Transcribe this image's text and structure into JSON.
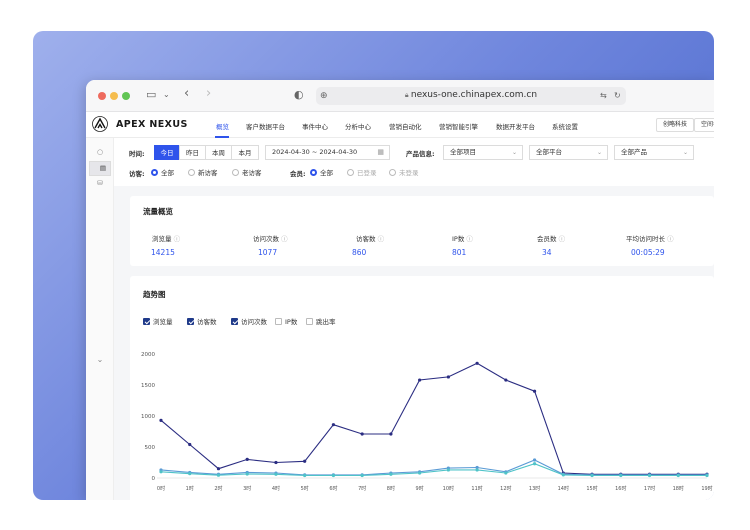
{
  "browser": {
    "url": "nexus-one.chinapex.com.cn"
  },
  "brand": {
    "name": "APEX NEXUS"
  },
  "nav": [
    {
      "label": "概览",
      "active": true
    },
    {
      "label": "客户数据平台"
    },
    {
      "label": "事件中心"
    },
    {
      "label": "分析中心"
    },
    {
      "label": "营销自动化"
    },
    {
      "label": "营销智能引擎"
    },
    {
      "label": "数据开发平台"
    },
    {
      "label": "系统设置"
    }
  ],
  "header_buttons": [
    "创略科技",
    "空间名称"
  ],
  "filters": {
    "time_label": "时间:",
    "time_tabs": [
      "今日",
      "昨日",
      "本周",
      "本月"
    ],
    "date_range": "2024-04-30 ~ 2024-04-30",
    "product_label": "产品信息:",
    "product_selects": [
      "全部项目",
      "全部平台",
      "全部产品"
    ],
    "visitor_label": "访客:",
    "visitor_options": [
      "全部",
      "新访客",
      "老访客"
    ],
    "member_label": "会员:",
    "member_options": [
      "全部",
      "已登录",
      "未登录"
    ]
  },
  "overview": {
    "title": "流量概览",
    "metrics": [
      {
        "label": "浏览量",
        "value": "14215"
      },
      {
        "label": "访问次数",
        "value": "1077"
      },
      {
        "label": "访客数",
        "value": "860"
      },
      {
        "label": "IP数",
        "value": "801"
      },
      {
        "label": "会员数",
        "value": "34"
      },
      {
        "label": "平均访问时长",
        "value": "00:05:29"
      }
    ]
  },
  "trend": {
    "title": "趋势图",
    "checkboxes": [
      {
        "label": "浏览量",
        "checked": true
      },
      {
        "label": "访客数",
        "checked": true
      },
      {
        "label": "访问次数",
        "checked": true
      },
      {
        "label": "IP数",
        "checked": false
      },
      {
        "label": "跳出率",
        "checked": false
      }
    ]
  },
  "chart_data": {
    "type": "line",
    "x": [
      "0时",
      "1时",
      "2时",
      "3时",
      "4时",
      "5时",
      "6时",
      "7时",
      "8时",
      "9时",
      "10时",
      "11时",
      "12时",
      "13时",
      "14时",
      "15时",
      "16时",
      "17时",
      "18时",
      "19时"
    ],
    "yticks": [
      0,
      500,
      1000,
      1500,
      2000
    ],
    "ylim": [
      0,
      2000
    ],
    "grid": false,
    "series": [
      {
        "name": "浏览量",
        "color": "#2b2d82",
        "values": [
          930,
          540,
          150,
          300,
          250,
          270,
          860,
          710,
          710,
          1580,
          1630,
          1850,
          1580,
          1400,
          80,
          60,
          60,
          60,
          60,
          60
        ]
      },
      {
        "name": "访客数",
        "color": "#5b9bd5",
        "values": [
          130,
          90,
          60,
          90,
          80,
          50,
          50,
          50,
          80,
          100,
          160,
          170,
          100,
          290,
          60,
          50,
          50,
          50,
          50,
          50
        ]
      },
      {
        "name": "访问次数",
        "color": "#4fc3c8",
        "values": [
          100,
          70,
          45,
          65,
          60,
          40,
          40,
          40,
          60,
          80,
          130,
          130,
          80,
          230,
          50,
          40,
          40,
          40,
          40,
          40
        ]
      }
    ]
  }
}
